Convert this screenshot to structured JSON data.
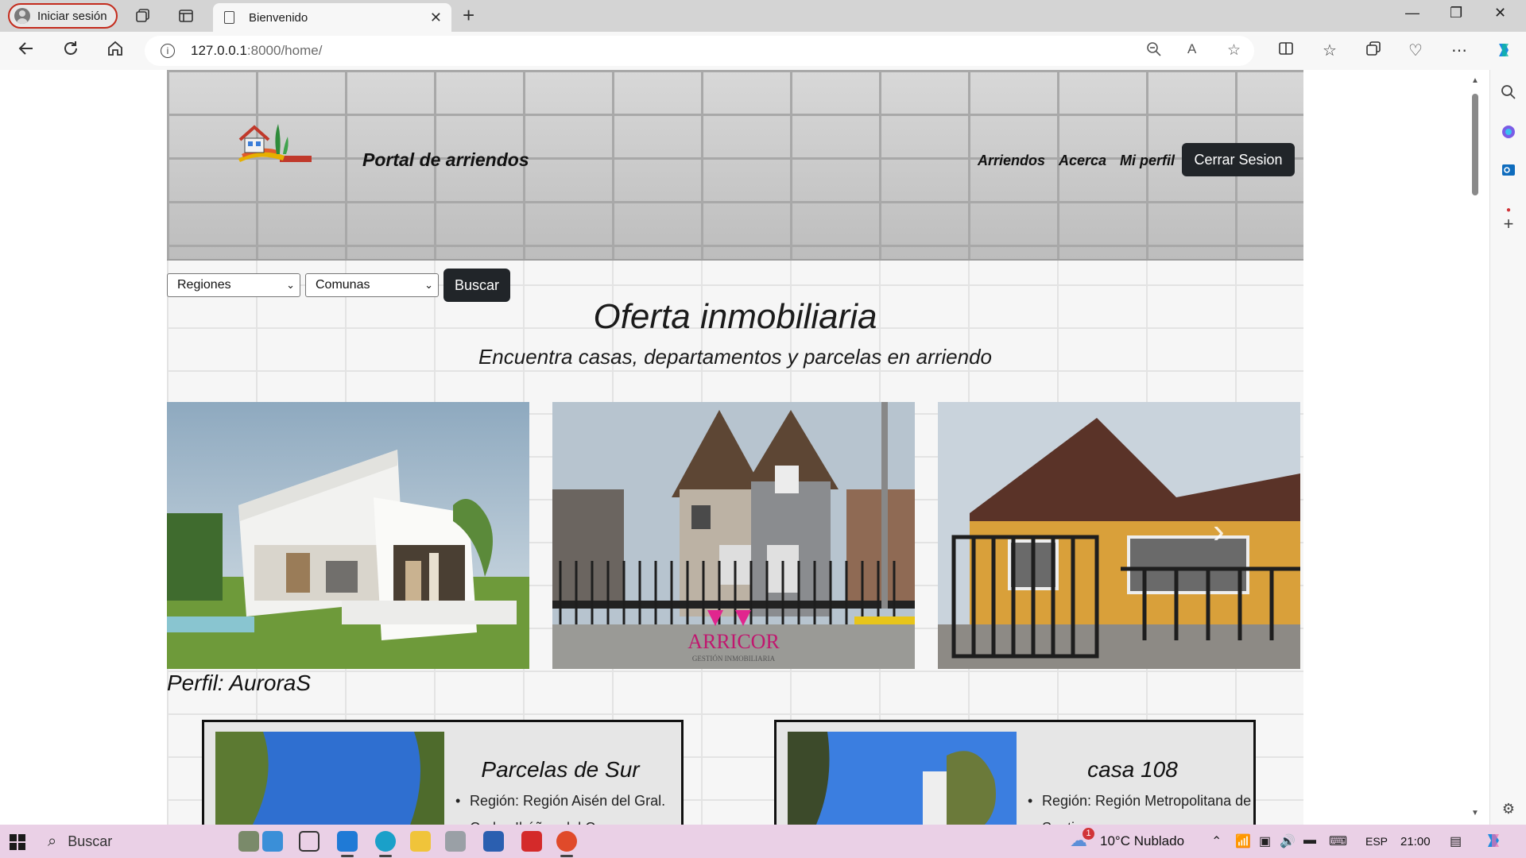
{
  "browser": {
    "profile_label": "Iniciar sesión",
    "tab_title": "Bienvenido",
    "url_host": "127.0.0.1",
    "url_path": ":8000/home/"
  },
  "site": {
    "title": "Portal de arriendos",
    "nav": [
      "Arriendos",
      "Acerca",
      "Mi perfil"
    ],
    "logout_label": "Cerrar Sesion"
  },
  "filters": {
    "region_selected": "Regiones",
    "comuna_selected": "Comunas",
    "search_label": "Buscar"
  },
  "hero": {
    "heading": "Oferta inmobiliaria",
    "subheading": "Encuentra casas, departamentos y parcelas en arriendo"
  },
  "carousel": {
    "watermark_brand": "ARRICOR",
    "watermark_sub": "GESTIÓN INMOBILIARIA"
  },
  "profile": {
    "label": "Perfil: AuroraS"
  },
  "listings": [
    {
      "title": "Parcelas de Sur",
      "region": "Región: Región Aisén del Gral. Carlos Ibáñez del Campo"
    },
    {
      "title": "casa 108",
      "region": "Región: Región Metropolitana de Santiago"
    }
  ],
  "taskbar": {
    "search_label": "Buscar",
    "weather": "10°C  Nublado",
    "weather_badge": "1",
    "lang": "ESP",
    "time": "21:00"
  },
  "colors": {
    "dark_button": "#212529",
    "taskbar": "#ead0e6",
    "profile_ring": "#c42b1c"
  }
}
